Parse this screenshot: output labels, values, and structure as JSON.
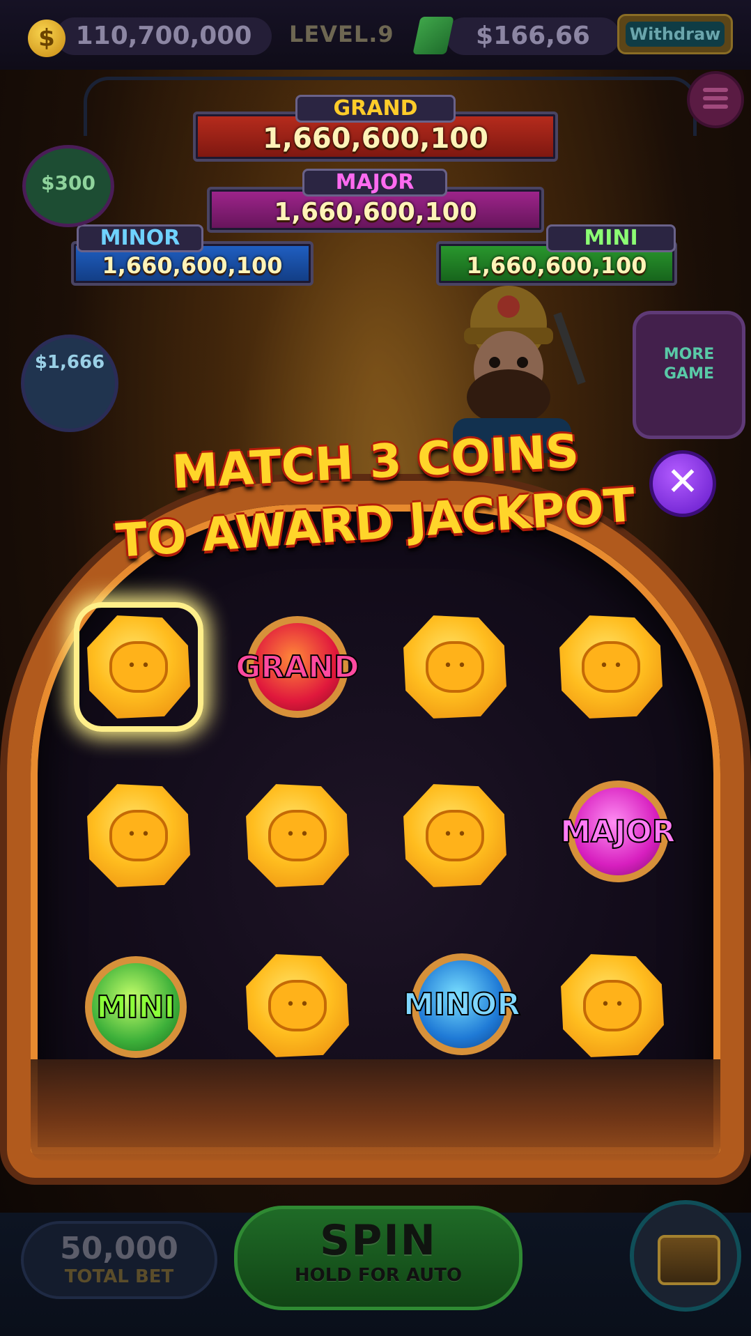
{
  "topbar": {
    "coins": "110,700,000",
    "level": "LEVEL.9",
    "cash": "$166,66",
    "withdraw_label": "Withdraw"
  },
  "jackpots": {
    "grand": {
      "label": "GRAND",
      "value": "1,660,600,100"
    },
    "major": {
      "label": "MAJOR",
      "value": "1,660,600,100"
    },
    "minor": {
      "label": "MINOR",
      "value": "1,660,600,100"
    },
    "mini": {
      "label": "MINI",
      "value": "1,660,600,100"
    }
  },
  "side": {
    "cash_bonus": "$300",
    "video_bonus": "$1,666",
    "more_game": "MORE GAME"
  },
  "popup": {
    "title_line1": "MATCH 3 COINS",
    "title_line2": "TO AWARD JACKPOT",
    "grid": [
      [
        "hamster-coin",
        "GRAND",
        "hamster-coin",
        "hamster-coin"
      ],
      [
        "hamster-coin",
        "hamster-coin",
        "hamster-coin",
        "MAJOR"
      ],
      [
        "MINI",
        "hamster-coin",
        "MINOR",
        "hamster-coin"
      ]
    ],
    "selected_cell": "row 1, col 1"
  },
  "bottom": {
    "bet_value": "50,000",
    "bet_label": "TOTAL BET",
    "spin_label": "SPIN",
    "spin_sub": "HOLD FOR AUTO"
  },
  "colors": {
    "grand": "#e0183c",
    "major": "#d71fbf",
    "minor": "#1f7ad6",
    "mini": "#3db03a",
    "title": "#ffd52a"
  }
}
